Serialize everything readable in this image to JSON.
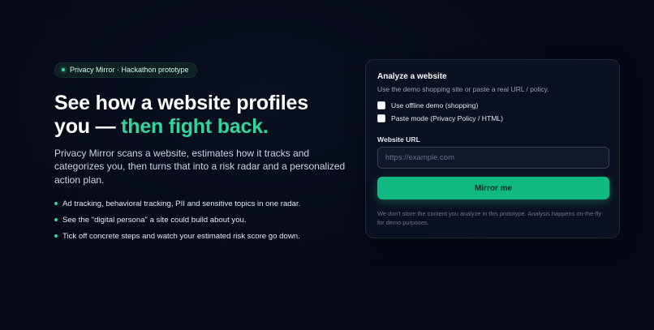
{
  "hero": {
    "badge": "Privacy Mirror · Hackathon prototype",
    "headline_main": "See how a website profiles you — ",
    "headline_accent": "then fight back.",
    "lead": "Privacy Mirror scans a website, estimates how it tracks and categorizes you, then turns that into a risk radar and a personalized action plan.",
    "bullets": [
      "Ad tracking, behavioral tracking, PII and sensitive topics in one radar.",
      "See the \"digital persona\" a site could build about you.",
      "Tick off concrete steps and watch your estimated risk score go down."
    ],
    "accent_color": "#34d399"
  },
  "card": {
    "title": "Analyze a website",
    "subtitle": "Use the demo shopping site or paste a real URL / policy.",
    "options": [
      {
        "label": "Use offline demo (shopping)",
        "checked": false
      },
      {
        "label": "Paste mode (Privacy Policy / HTML)",
        "checked": false
      }
    ],
    "url_label": "Website URL",
    "url_placeholder": "https://example.com",
    "url_value": "",
    "submit_label": "Mirror me",
    "disclaimer": "We don't store the content you analyze in this prototype. Analysis happens on-the-fly for demo purposes.",
    "button_color": "#10b981"
  }
}
